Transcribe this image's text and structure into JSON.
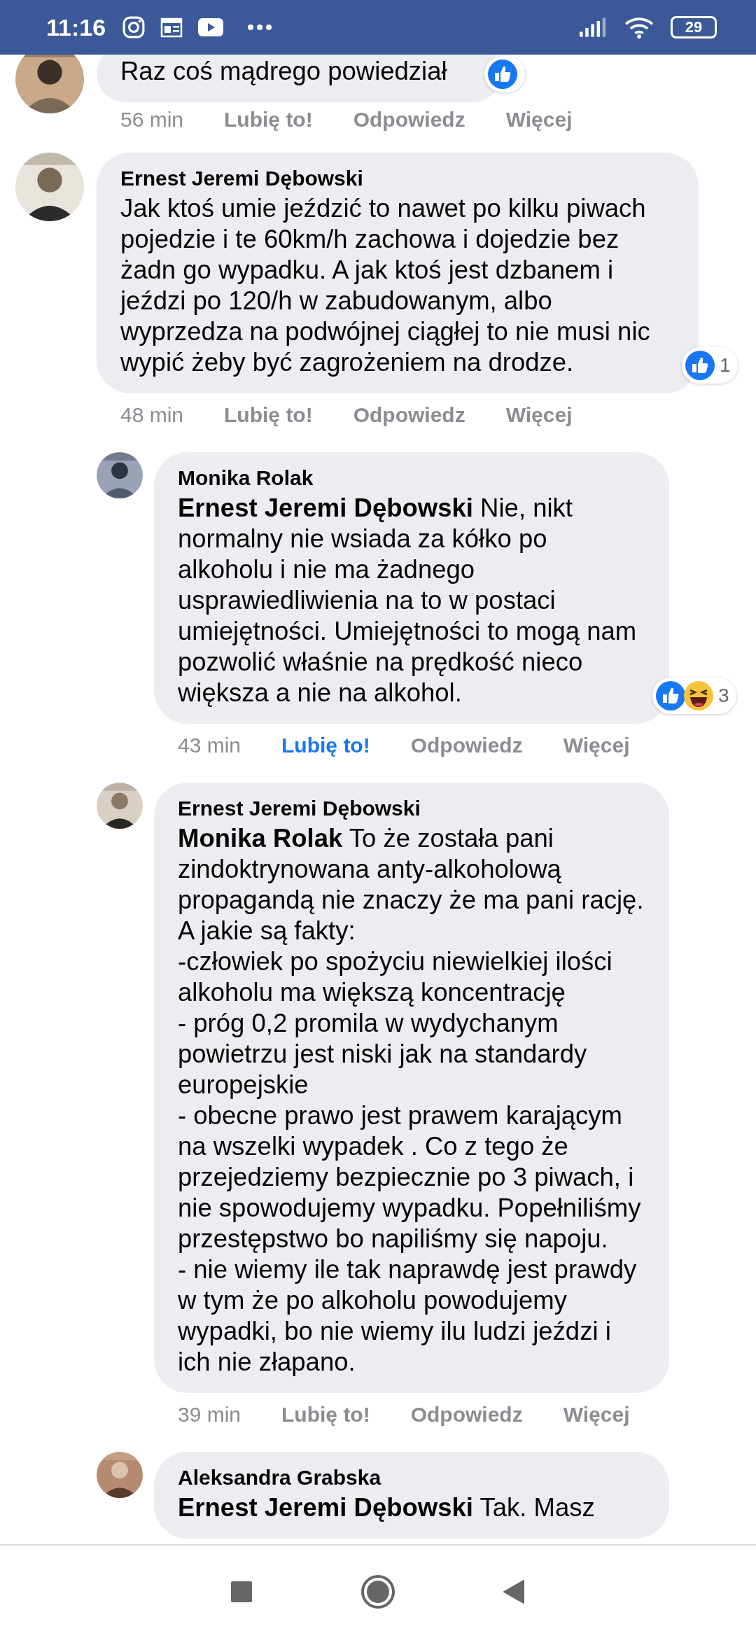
{
  "status_bar": {
    "time": "11:16",
    "notification_icons": [
      {
        "kind": "instagram"
      },
      {
        "kind": "calendar"
      },
      {
        "kind": "youtube"
      },
      {
        "kind": "more"
      }
    ],
    "battery": "29"
  },
  "comments": [
    {
      "avatar": {
        "kind": "picture"
      },
      "text": "Raz coś mądrego powiedział",
      "reactions": {
        "types": [
          {
            "kind": "like"
          }
        ]
      },
      "time": "56 min",
      "actions": [
        {
          "label": "Lubię to!",
          "selected": false
        },
        {
          "label": "Odpowiedz",
          "selected": false
        },
        {
          "label": "Więcej",
          "selected": false
        }
      ]
    },
    {
      "author": "Ernest Jeremi Dębowski",
      "avatar": {
        "kind": "picture"
      },
      "text": "Jak ktoś umie jeździć to nawet po kilku piwach pojedzie i te 60km/h zachowa i dojedzie bez żadn go wypadku. A jak ktoś jest dzbanem i jeździ po 120/h w zabudowanym, albo wyprzedza na podwójnej ciągłej to nie musi nic wypić żeby być zagrożeniem na drodze.",
      "reactions": {
        "types": [
          {
            "kind": "like"
          }
        ],
        "count": "1"
      },
      "time": "48 min",
      "actions": [
        {
          "label": "Lubię to!",
          "selected": false
        },
        {
          "label": "Odpowiedz",
          "selected": false
        },
        {
          "label": "Więcej",
          "selected": false
        }
      ],
      "children": [
        {
          "author": "Monika Rolak",
          "avatar": {
            "kind": "picture"
          },
          "text": "**Ernest Jeremi Dębowski** Nie, nikt normalny nie wsiada za kółko po alkoholu i nie ma żadnego usprawiedliwienia na to w postaci umiejętności. Umiejętności to mogą nam pozwolić właśnie na prędkość nieco większa a nie na alkohol.",
          "reactions": {
            "types": [
              {
                "kind": "like"
              },
              {
                "kind": "haha"
              }
            ],
            "count": "3"
          },
          "time": "43 min",
          "actions": [
            {
              "label": "Lubię to!",
              "selected": true
            },
            {
              "label": "Odpowiedz",
              "selected": false
            },
            {
              "label": "Więcej",
              "selected": false
            }
          ]
        },
        {
          "author": "Ernest Jeremi Dębowski",
          "avatar": {
            "kind": "picture"
          },
          "text": "**Monika Rolak** To że została pani zindoktrynowana anty-alkoholową propagandą nie znaczy że ma pani rację. A jakie są fakty:\n-człowiek po spożyciu niewielkiej ilości alkoholu ma większą koncentrację\n- próg 0,2 promila w wydychanym powietrzu jest niski jak na standardy europejskie\n- obecne prawo jest prawem karającym na wszelki wypadek . Co z tego że przejedziemy bezpiecznie po 3 piwach, i nie spowodujemy wypadku. Popełniliśmy przestępstwo bo napiliśmy się napoju.\n- nie wiemy ile tak naprawdę jest prawdy w tym że po alkoholu powodujemy wypadki, bo nie wiemy ilu ludzi jeździ i ich nie złapano.",
          "time": "39 min",
          "actions": [
            {
              "label": "Lubię to!",
              "selected": false
            },
            {
              "label": "Odpowiedz",
              "selected": false
            },
            {
              "label": "Więcej",
              "selected": false
            }
          ]
        },
        {
          "author": "Aleksandra Grabska",
          "avatar": {
            "kind": "picture"
          },
          "text": "**Ernest Jeremi Dębowski** Tak. Masz"
        }
      ]
    }
  ],
  "nav_bar": [
    {
      "kind": "recents"
    },
    {
      "kind": "home"
    },
    {
      "kind": "back"
    }
  ]
}
